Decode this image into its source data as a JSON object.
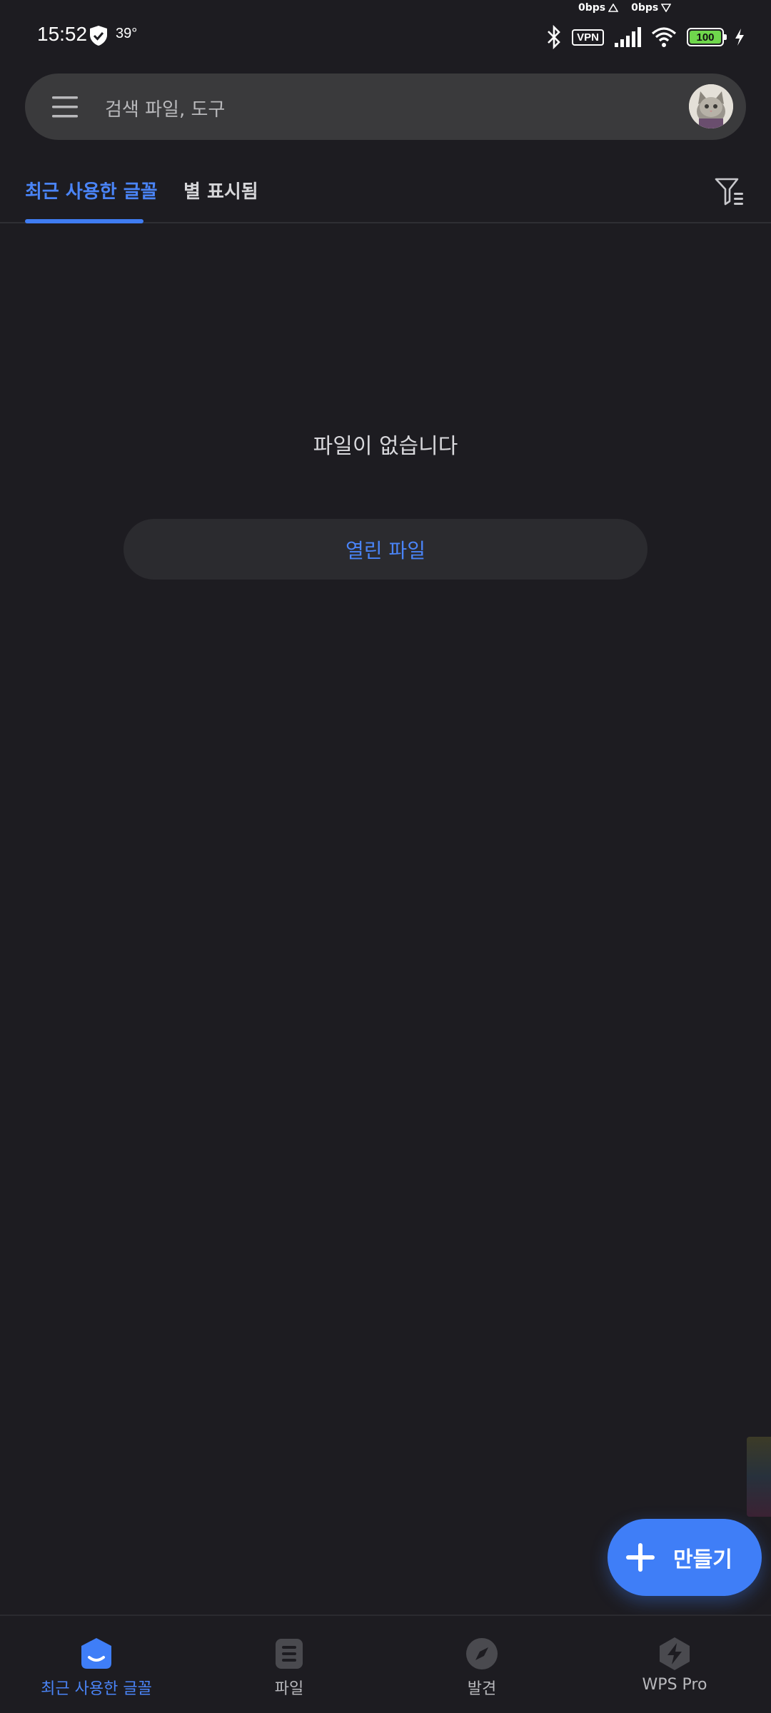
{
  "status_bar": {
    "net_up": "0bps",
    "net_down": "0bps",
    "time": "15:52",
    "temperature": "39°",
    "vpn": "VPN",
    "battery": "100",
    "icons": [
      "shield-check-icon",
      "bluetooth-icon",
      "signal-icon",
      "wifi-icon",
      "battery-icon",
      "charging-icon"
    ]
  },
  "search": {
    "placeholder": "검색 파일, 도구"
  },
  "tabs": {
    "recent": "최근 사용한 글꼴",
    "starred": "별 표시됨",
    "active": "recent"
  },
  "empty_state": {
    "message": "파일이 없습니다",
    "open_button": "열린 파일"
  },
  "fab": {
    "label": "만들기"
  },
  "bottom_nav": {
    "items": [
      {
        "label": "최근 사용한 글꼴",
        "icon": "home-icon",
        "active": true
      },
      {
        "label": "파일",
        "icon": "file-list-icon",
        "active": false
      },
      {
        "label": "발견",
        "icon": "compass-icon",
        "active": false
      },
      {
        "label": "WPS Pro",
        "icon": "lightning-icon",
        "active": false
      }
    ]
  },
  "colors": {
    "background": "#1d1c21",
    "accent": "#3f7ef7",
    "surface": "#3a3a3c",
    "button_surface": "#2b2b2f"
  }
}
